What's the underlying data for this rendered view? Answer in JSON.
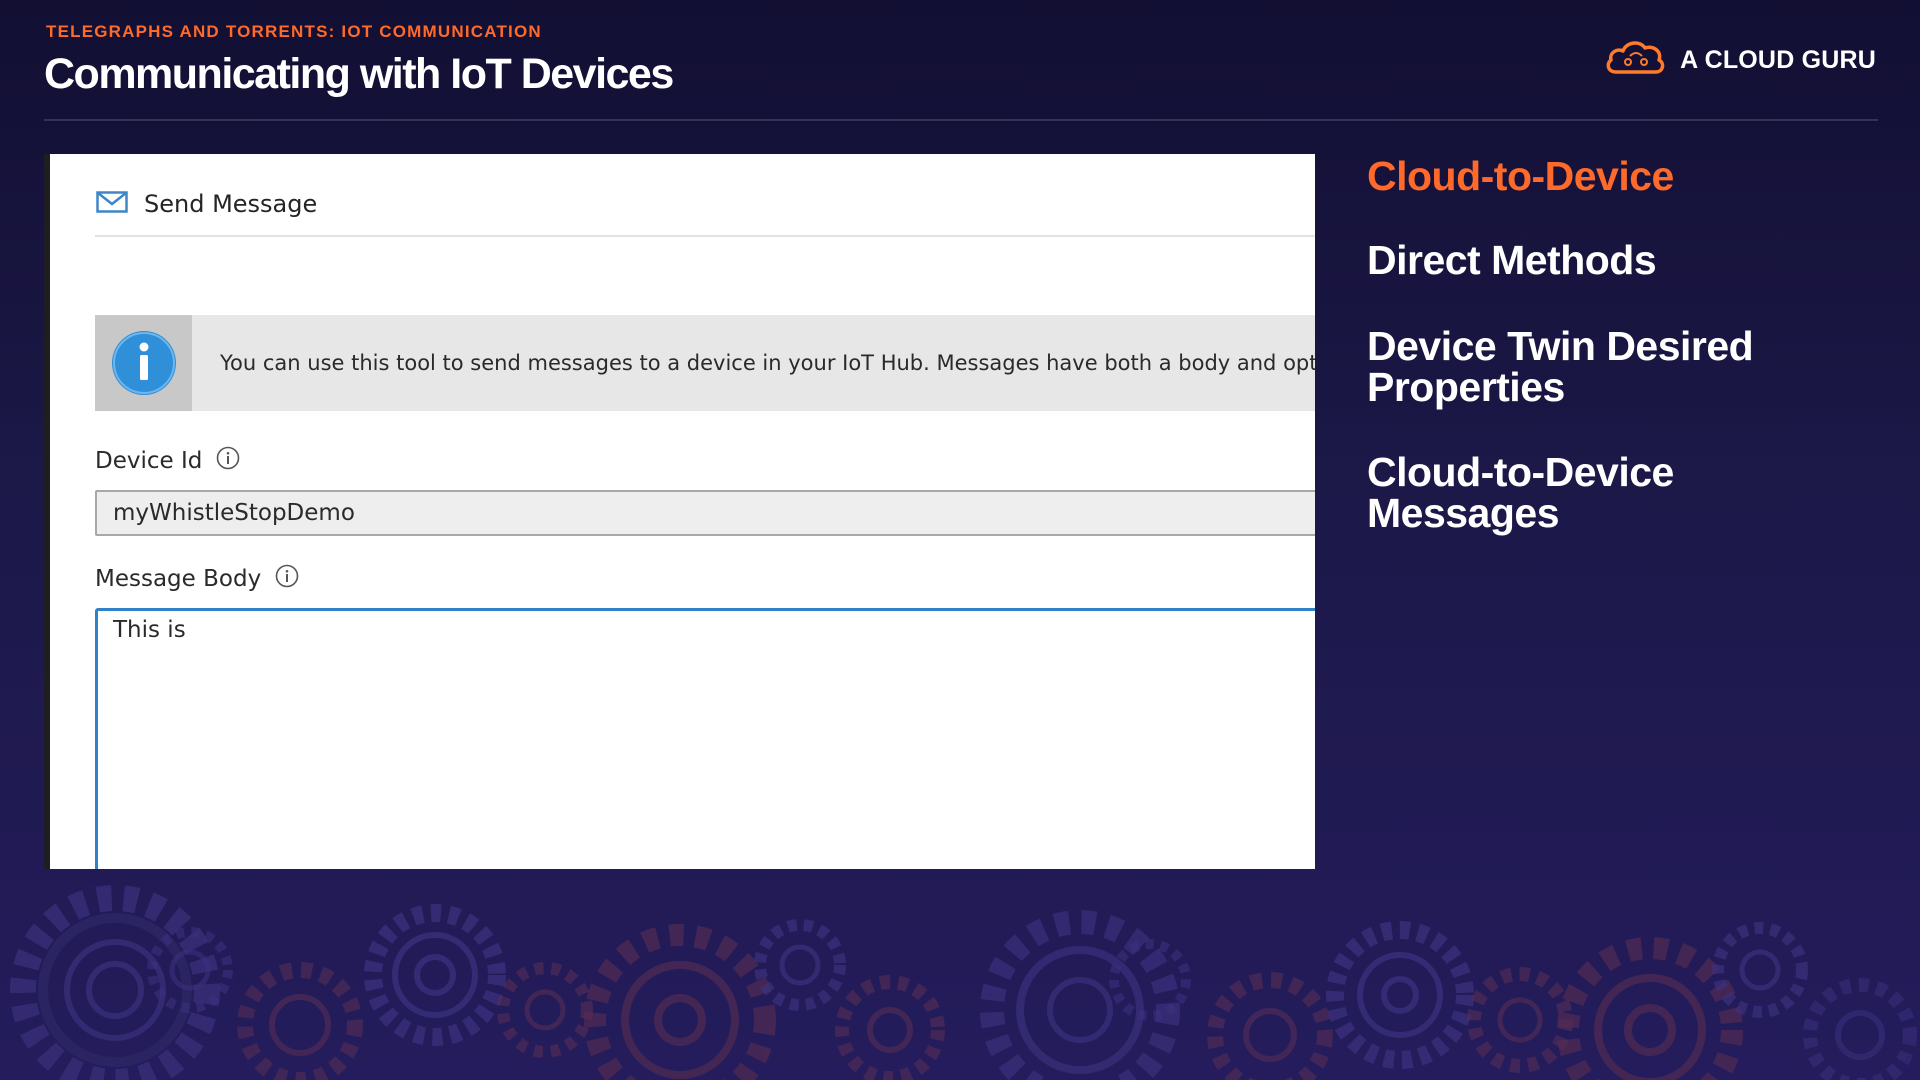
{
  "header": {
    "kicker": "TELEGRAPHS AND TORRENTS: IOT COMMUNICATION",
    "title": "Communicating with IoT Devices",
    "brand": "A CLOUD GURU",
    "brand_icon": "cloud-icon"
  },
  "send_message": {
    "title": "Send Message",
    "title_icon": "envelope-icon",
    "info_text": "You can use this tool to send messages to a device in your IoT Hub. Messages have both a body and optional properties.",
    "info_icon": "info-icon",
    "device_id_label": "Device Id",
    "device_id_value": "myWhistleStopDemo",
    "message_body_label": "Message Body",
    "message_body_value": "This is"
  },
  "topics": [
    {
      "label": "Cloud-to-Device",
      "active": true
    },
    {
      "label": "Direct Methods",
      "active": false
    },
    {
      "label": "Device Twin Desired Properties",
      "active": false
    },
    {
      "label": "Cloud-to-Device Messages",
      "active": false
    }
  ],
  "colors": {
    "accent": "#ff6a2b",
    "background": "#1c1848",
    "input_focus": "#2f82c8",
    "info_blue": "#2f8fd8"
  }
}
